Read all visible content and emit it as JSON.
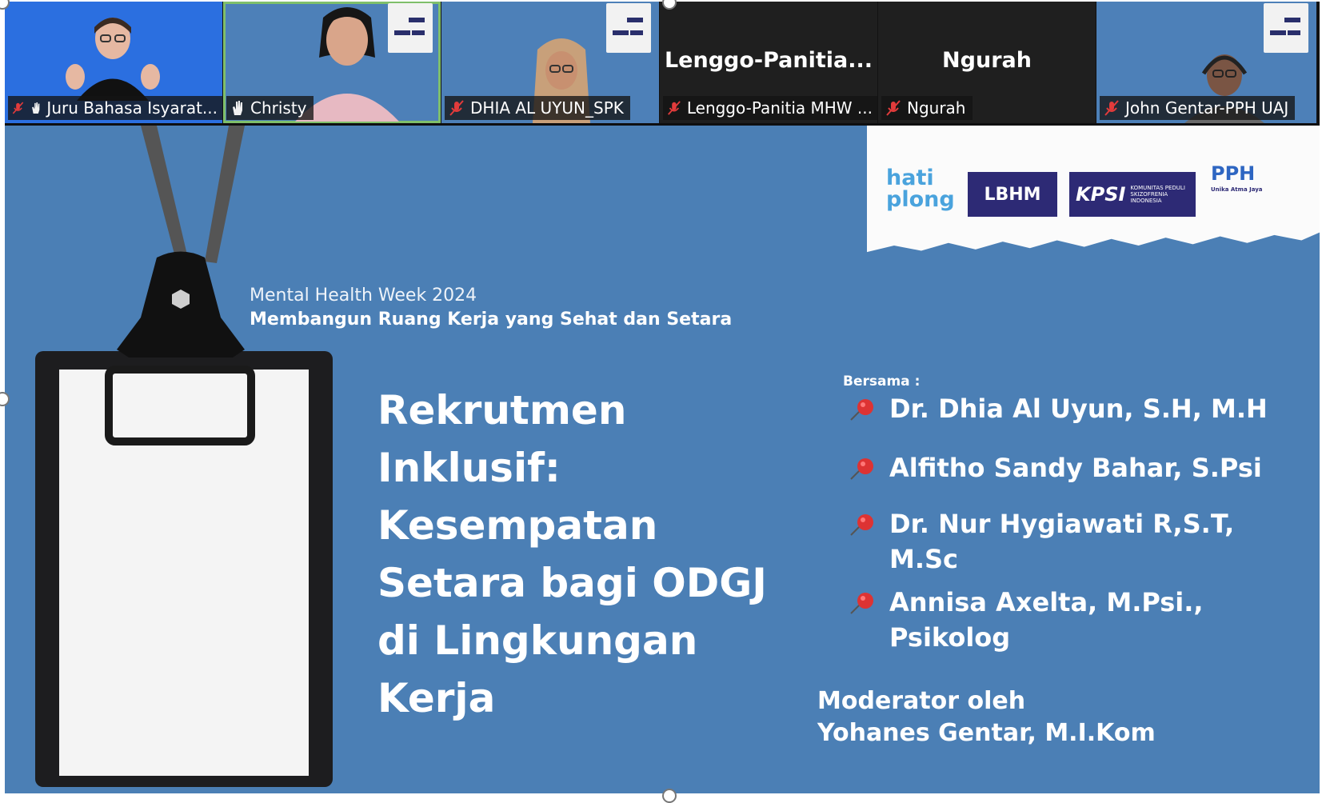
{
  "participants": [
    {
      "label": "Juru Bahasa Isyarat...",
      "muted": true,
      "hand": true,
      "bg": "#2b6fe0"
    },
    {
      "label": "Christy",
      "muted": false,
      "hand": true,
      "active": true
    },
    {
      "label": "DHIA AL UYUN_SPK",
      "muted": true
    },
    {
      "big_name": "Lenggo-Panitia...",
      "label": "Lenggo-Panitia MHW ...",
      "muted": true
    },
    {
      "big_name": "Ngurah",
      "label": "Ngurah",
      "muted": true
    },
    {
      "label": "John Gentar-PPH UAJ",
      "muted": true
    }
  ],
  "slide": {
    "bg_color": "#4b7fb5",
    "logos": {
      "hati_line1": "hati",
      "hati_line2": "plong",
      "lbhm": "LBHM",
      "kpsi": "KPSI",
      "kpsi_small": "KOMUNITAS PEDULI SKIZOFRENIA INDONESIA",
      "pph": "PPH",
      "pph_sub": "Unika Atma Jaya"
    },
    "event_title": "Mental Health Week 2024",
    "event_subtitle": "Membangun Ruang Kerja yang Sehat dan Setara",
    "topic_lines": [
      "Rekrutmen",
      "Inklusif:",
      "Kesempatan",
      "Setara bagi ODGJ",
      "di Lingkungan",
      "Kerja"
    ],
    "bersama_label": "Bersama :",
    "speakers": [
      "Dr. Dhia Al Uyun, S.H, M.H",
      "Alfitho Sandy Bahar, S.Psi",
      "Dr. Nur Hygiawati R,S.T, M.Sc",
      "Annisa Axelta, M.Psi., Psikolog"
    ],
    "moderator_label": "Moderator oleh",
    "moderator_name": "Yohanes Gentar, M.I.Kom"
  }
}
